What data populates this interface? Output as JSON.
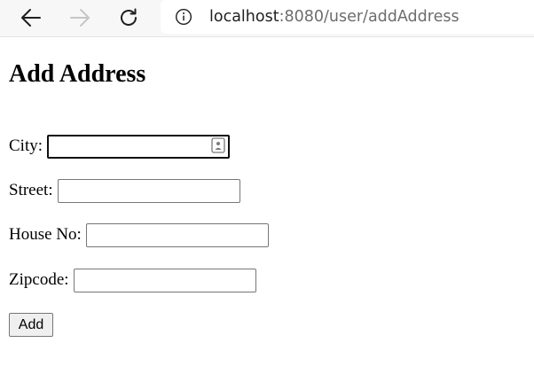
{
  "browser": {
    "url_host": "localhost",
    "url_path": ":8080/user/addAddress"
  },
  "page": {
    "title": "Add Address",
    "fields": [
      {
        "label": "City:",
        "value": "",
        "placeholder": ""
      },
      {
        "label": "Street:",
        "value": "",
        "placeholder": ""
      },
      {
        "label": "House No:",
        "value": "",
        "placeholder": ""
      },
      {
        "label": "Zipcode:",
        "value": "",
        "placeholder": ""
      }
    ],
    "submit_label": "Add"
  },
  "icons": {
    "back": "back-arrow-icon",
    "forward": "forward-arrow-icon",
    "reload": "reload-icon",
    "info": "info-icon",
    "autofill": "contact-card-icon"
  },
  "colors": {
    "toolbar_bg": "#f7f7f7",
    "url_host": "#1f1f1f",
    "url_path": "#6d6d6d",
    "forward_disabled": "#c6c6c6"
  }
}
